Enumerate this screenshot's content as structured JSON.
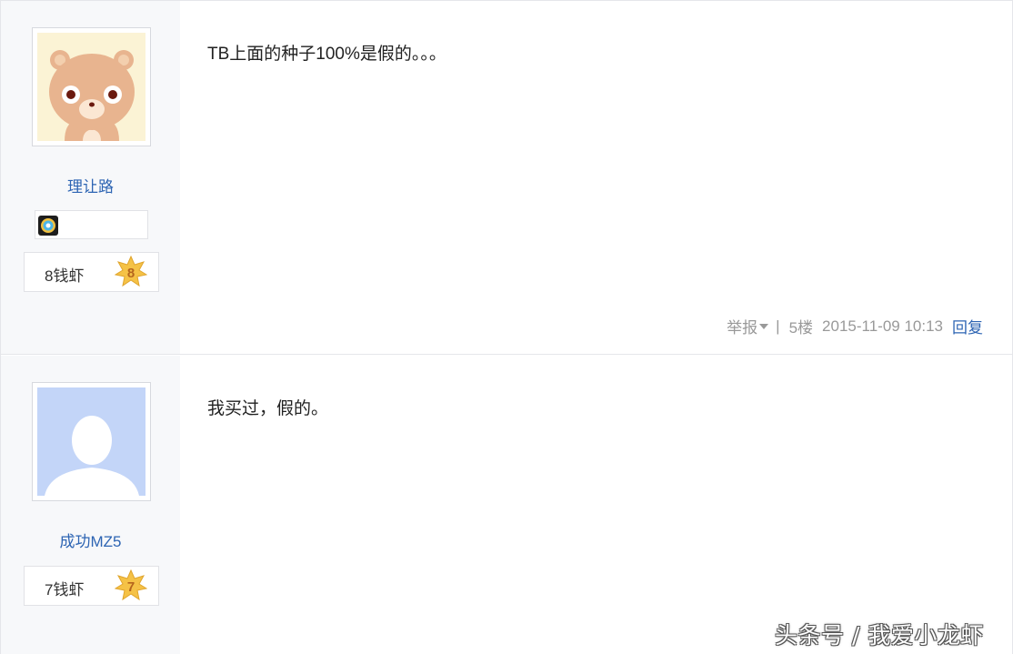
{
  "posts": [
    {
      "username": "理让路",
      "level_label": "8钱虾",
      "level_num": "8",
      "content": "TB上面的种子100%是假的。。。",
      "meta": {
        "report": "举报",
        "separator": "|",
        "floor": "5楼",
        "time": "2015-11-09 10:13",
        "reply": "回复"
      }
    },
    {
      "username": "成功MZ5",
      "level_label": "7钱虾",
      "level_num": "7",
      "content": "我买过，假的。"
    }
  ],
  "watermark": "头条号 / 我爱小龙虾",
  "colors": {
    "link": "#2d64b3",
    "meta": "#999999",
    "side_bg": "#f7f8fa",
    "star": "#f5c246"
  }
}
